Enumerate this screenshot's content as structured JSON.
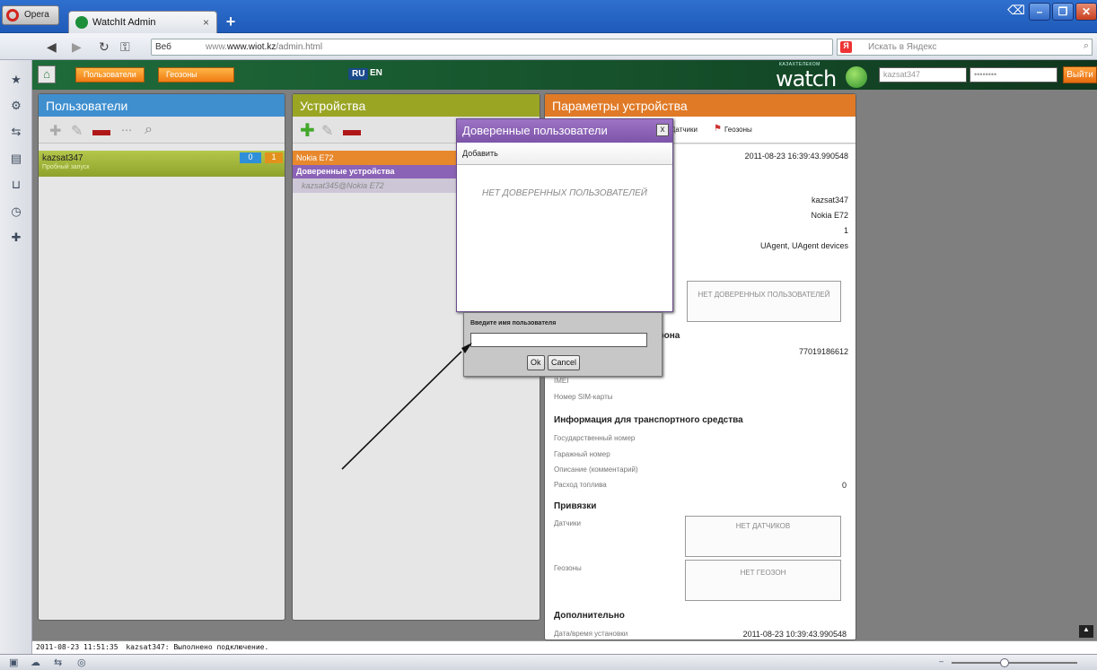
{
  "browser": {
    "menu_label": "Opera",
    "tab_title": "WatchIt Admin",
    "tab_close": "×",
    "new_tab": "+",
    "url_prefix": "Веб",
    "url_host": "www.wiot.kz",
    "url_path": "/admin.html",
    "search_placeholder": "Искать в Яндекс",
    "search_logo": "Я"
  },
  "app": {
    "nav": {
      "users_button": "Пользователи",
      "geozones_button": "Геозоны",
      "lang_ru": "RU",
      "lang_en": "EN",
      "logo_tagline": "КАЗАХТЕЛЕКОМ",
      "logo_text": "watch",
      "username_value": "kazsat347",
      "password_value": "••••••••",
      "logout_button": "Выйти"
    },
    "users_panel": {
      "title": "Пользователи",
      "user": {
        "name": "kazsat347",
        "subtitle": "Пробный запуск",
        "count_a": "0",
        "count_b": "1"
      }
    },
    "devices_panel": {
      "title": "Устройства",
      "device": "Nokia E72",
      "trusted_header": "Доверенные устройства",
      "trusted_item": "kazsat345@Nokia E72"
    },
    "params_panel": {
      "title": "Параметры устройства",
      "tabs": [
        "Датчики",
        "Геозоны"
      ],
      "date": "2011-08-23 16:39:43.990548",
      "user": "kazsat347",
      "model": "Nokia E72",
      "number": "1",
      "groups": "UAgent, UAgent devices",
      "trusted_empty": "НЕТ ДОВЕРЕННЫХ ПОЛЬЗОВАТЕЛЕЙ",
      "phone_section": "Информация для телефона",
      "phone_section_visible": "фона",
      "phone_number": "77019186612",
      "imei_label": "IMEI",
      "sim_label": "Номер SIM-карты",
      "vehicle_section": "Информация для транспортного средства",
      "vehicle_fields": [
        "Государственный номер",
        "Гаражный номер",
        "Описание (комментарий)",
        "Расход топлива"
      ],
      "fuel_value": "0",
      "bindings_section": "Привязки",
      "sensors_label": "Датчики",
      "sensors_empty": "НЕТ ДАТЧИКОВ",
      "geozones_label": "Геозоны",
      "geozones_empty": "НЕТ ГЕОЗОН",
      "extra_section": "Дополнительно",
      "install_label": "Дата/время установки",
      "install_value": "2011-08-23 10:39:43.990548"
    },
    "dialog": {
      "title": "Доверенные пользователи",
      "close": "x",
      "add": "Добавить",
      "empty": "НЕТ ДОВЕРЕННЫХ ПОЛЬЗОВАТЕЛЕЙ"
    },
    "prompt": {
      "label": "Введите имя пользователя",
      "value": "",
      "ok": "Ok",
      "cancel": "Cancel"
    },
    "log": {
      "timestamp": "2011-08-23 11:51:35",
      "message": "kazsat347: Выполнено подключение."
    }
  },
  "colors": {
    "users_header": "#3f8fcf",
    "devices_header": "#9aa524",
    "params_header": "#e07a27",
    "dialog_header": "#8a62b6",
    "nav_green": "#1f6b3a"
  }
}
